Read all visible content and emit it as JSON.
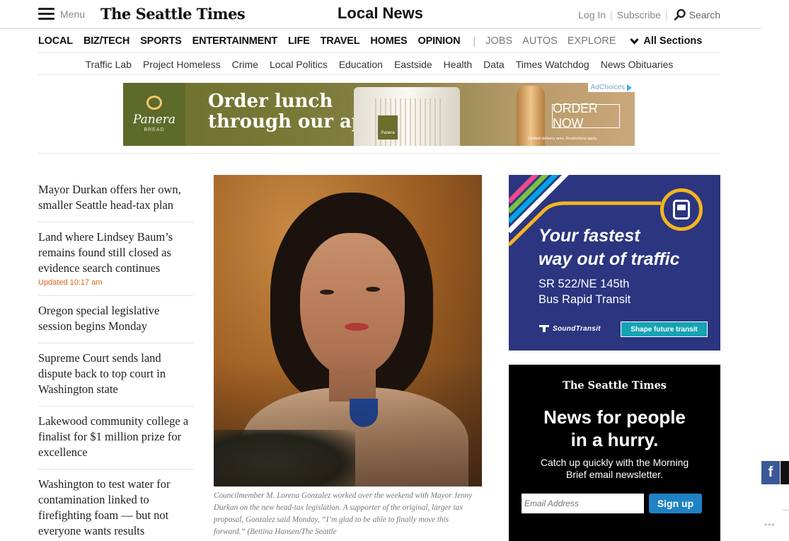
{
  "header": {
    "menu_label": "Menu",
    "logo_text": "The Seattle Times",
    "section_title": "Local News",
    "login": "Log In",
    "subscribe": "Subscribe",
    "search": "Search"
  },
  "main_nav": {
    "items": [
      "LOCAL",
      "BIZ/TECH",
      "SPORTS",
      "ENTERTAINMENT",
      "LIFE",
      "TRAVEL",
      "HOMES",
      "OPINION"
    ],
    "secondary": [
      "JOBS",
      "AUTOS",
      "EXPLORE"
    ],
    "all_sections": "All Sections"
  },
  "sub_nav": {
    "items": [
      "Traffic Lab",
      "Project Homeless",
      "Crime",
      "Local Politics",
      "Education",
      "Eastside",
      "Health",
      "Data",
      "Times Watchdog",
      "News Obituaries"
    ]
  },
  "banner_ad": {
    "brand": "Panera",
    "brand_sub": "BREAD",
    "headline_1": "Order lunch",
    "headline_2": "through our app.",
    "cta": "ORDER NOW",
    "adchoices": "AdChoices",
    "cup_label": "Panera",
    "fine_print": "Limited delivery area. Restrictions apply."
  },
  "stories": [
    {
      "title": "Mayor Durkan offers her own, smaller Seattle head-tax plan",
      "updated": ""
    },
    {
      "title": "Land where Lindsey Baum’s remains found still closed as evidence search continues",
      "updated": "Updated 10:17 am"
    },
    {
      "title": "Oregon special legislative session begins Monday",
      "updated": ""
    },
    {
      "title": "Supreme Court sends land dispute back to top court in Washington state",
      "updated": ""
    },
    {
      "title": "Lakewood community college a finalist for $1 million prize for excellence",
      "updated": ""
    },
    {
      "title": "Washington to test water for contamination linked to firefighting foam — but not everyone wants results",
      "updated": ""
    }
  ],
  "lead_photo": {
    "caption": "Councilmember M. Lorena Gonzalez worked over the weekend with Mayor Jenny Durkan on the new head-tax legislation. A supporter of the original, larger tax proposal, Gonzalez said Monday, “I’m glad to be able to finally move this forward.” (Bettina Hansen/The Seattle"
  },
  "transit_ad": {
    "headline_1": "Your fastest",
    "headline_2": "way out of traffic",
    "line_1": "SR 522/NE 145th",
    "line_2": "Bus Rapid Transit",
    "brand": "SoundTransit",
    "cta": "Shape future transit",
    "colors": {
      "bg": "#2b3580",
      "accent": "#f5b51e",
      "cta": "#16a3b3"
    }
  },
  "newsletter_ad": {
    "logo_text": "The Seattle Times",
    "headline_1": "News for people",
    "headline_2": "in a hurry.",
    "body": "Catch up quickly with the Morning Brief email newsletter.",
    "email_placeholder": "Email Address",
    "signup": "Sign up"
  },
  "share": {
    "facebook": "f",
    "more": "•••"
  }
}
